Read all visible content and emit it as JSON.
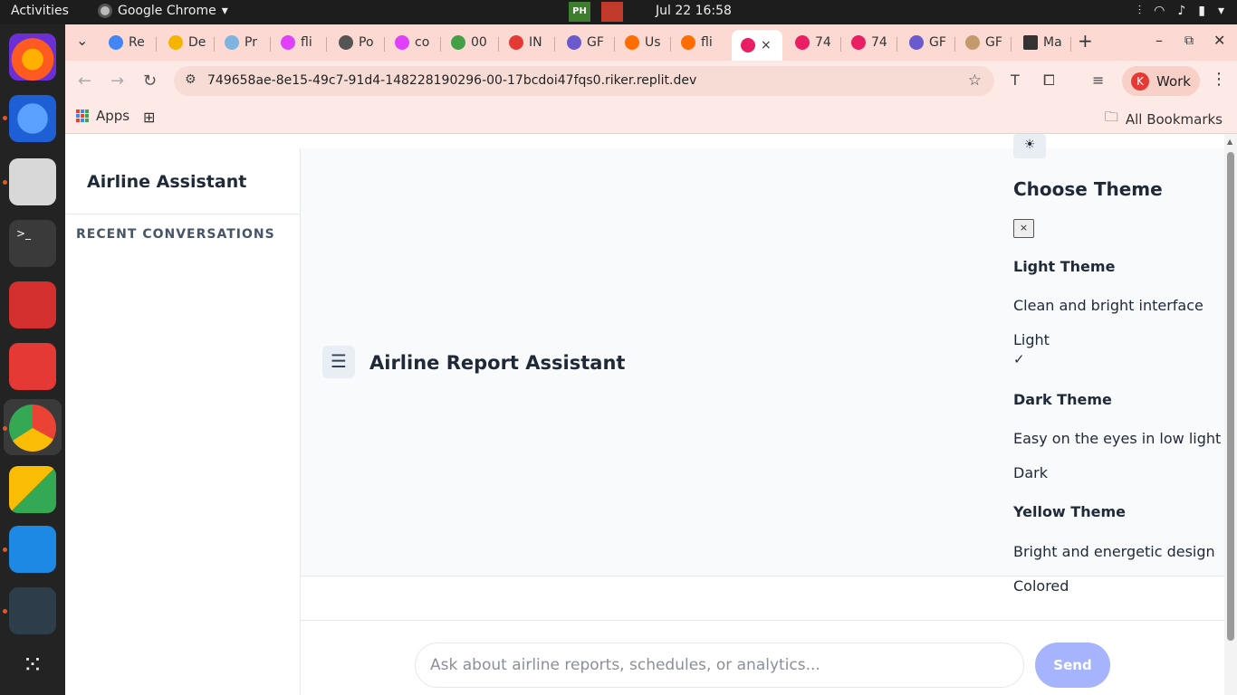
{
  "os": {
    "activities": "Activities",
    "app_name": "Google Chrome",
    "clock": "Jul 22  16:58",
    "ph_label": "PH"
  },
  "browser": {
    "tabs": [
      "Re",
      "De",
      "Pr",
      "fli",
      "Po",
      "co",
      "00",
      "IN",
      "GF",
      "Us",
      "fli",
      "",
      "74",
      "74",
      "GF",
      "GF",
      "Ma"
    ],
    "url": "749658ae-8e15-49c7-91d4-148228190296-00-17bcdoi47fqs0.riker.replit.dev",
    "profile_initial": "K",
    "profile_label": "Work",
    "apps_label": "Apps",
    "all_bookmarks": "All Bookmarks"
  },
  "sidebar": {
    "title": "Airline Assistant",
    "recent_label": "RECENT CONVERSATIONS"
  },
  "main": {
    "title": "Airline Report Assistant",
    "input_placeholder": "Ask about airline reports, schedules, or analytics...",
    "send_label": "Send"
  },
  "theme_panel": {
    "sun_icon": "☀",
    "heading": "Choose Theme",
    "close_label": "×",
    "themes": [
      {
        "name": "Light Theme",
        "description": "Clean and bright interface",
        "option": "Light",
        "selected": "✓"
      },
      {
        "name": "Dark Theme",
        "description": "Easy on the eyes in low light",
        "option": "Dark"
      },
      {
        "name": "Yellow Theme",
        "description": "Bright and energetic design",
        "option": "Colored"
      }
    ]
  },
  "colors": {
    "send_button": "#a5b4fc",
    "tabstrip": "#fcd9d3",
    "header_bg": "#f8fafc"
  }
}
